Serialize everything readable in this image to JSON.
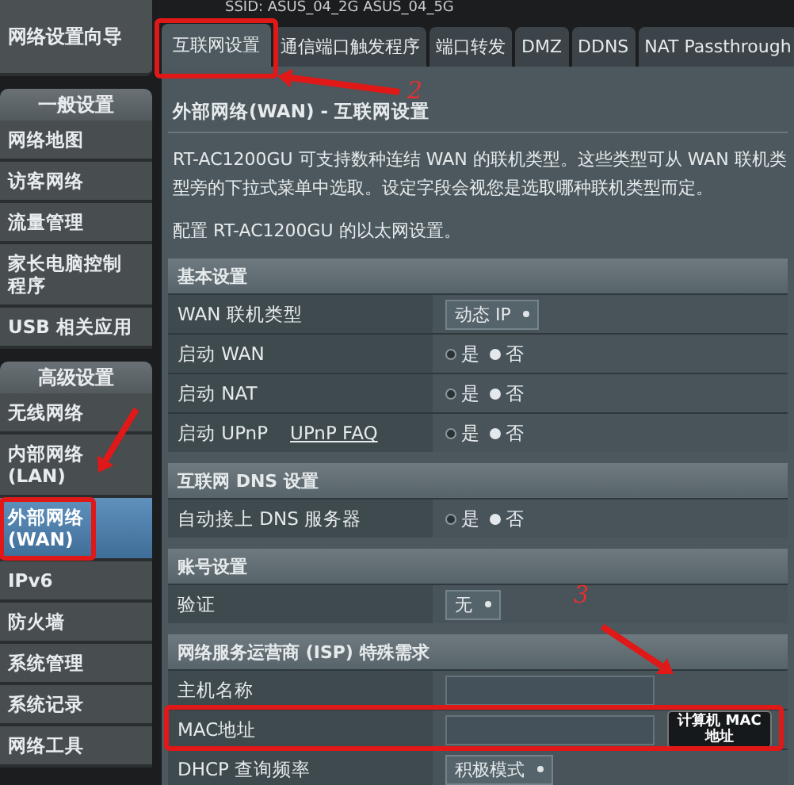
{
  "ssid": "SSID: ASUS_04_2G  ASUS_04_5G",
  "sidebar": {
    "wizard": "网络设置向导",
    "groups": [
      {
        "title": "一般设置",
        "items": [
          {
            "label": "网络地图",
            "selected": false
          },
          {
            "label": "访客网络",
            "selected": false
          },
          {
            "label": "流量管理",
            "selected": false
          },
          {
            "label": "家长电脑控制程序",
            "selected": false
          },
          {
            "label": "USB 相关应用",
            "selected": false
          }
        ]
      },
      {
        "title": "高级设置",
        "items": [
          {
            "label": "无线网络",
            "selected": false
          },
          {
            "label": "内部网络(LAN)",
            "selected": false
          },
          {
            "label": "外部网络(WAN)",
            "selected": true
          },
          {
            "label": "IPv6",
            "selected": false
          },
          {
            "label": "防火墙",
            "selected": false
          },
          {
            "label": "系统管理",
            "selected": false
          },
          {
            "label": "系统记录",
            "selected": false
          },
          {
            "label": "网络工具",
            "selected": false
          }
        ]
      }
    ]
  },
  "tabs": [
    {
      "label": "互联网设置",
      "selected": true
    },
    {
      "label": "通信端口触发程序",
      "selected": false
    },
    {
      "label": "端口转发",
      "selected": false
    },
    {
      "label": "DMZ",
      "selected": false
    },
    {
      "label": "DDNS",
      "selected": false
    },
    {
      "label": "NAT Passthrough",
      "selected": false
    }
  ],
  "page_title": "外部网络(WAN) - 互联网设置",
  "description": "RT-AC1200GU 可支持数种连结 WAN 的联机类型。这些类型可从 WAN 联机类型旁的下拉式菜单中选取。设定字段会视您是选取哪种联机类型而定。",
  "config_note": "配置 RT-AC1200GU 的以太网设置。",
  "sections": [
    {
      "title": "基本设置",
      "rows": [
        {
          "label": "WAN 联机类型",
          "kind": "select",
          "value": "动态 IP"
        },
        {
          "label": "启动 WAN",
          "kind": "radio",
          "options": [
            {
              "label": "是",
              "selected": false
            },
            {
              "label": "否",
              "selected": true
            }
          ]
        },
        {
          "label": "启动 NAT",
          "kind": "radio",
          "options": [
            {
              "label": "是",
              "selected": false
            },
            {
              "label": "否",
              "selected": true
            }
          ]
        },
        {
          "label": "启动 UPnP",
          "link": "UPnP  FAQ",
          "kind": "radio",
          "options": [
            {
              "label": "是",
              "selected": false
            },
            {
              "label": "否",
              "selected": true
            }
          ]
        }
      ]
    },
    {
      "title": "互联网 DNS 设置",
      "rows": [
        {
          "label": "自动接上 DNS 服务器",
          "kind": "radio",
          "options": [
            {
              "label": "是",
              "selected": false
            },
            {
              "label": "否",
              "selected": true
            }
          ]
        }
      ]
    },
    {
      "title": "账号设置",
      "rows": [
        {
          "label": "验证",
          "kind": "select",
          "value": "无"
        }
      ]
    },
    {
      "title": "网络服务运营商 (ISP) 特殊需求",
      "rows": [
        {
          "label": "主机名称",
          "kind": "text"
        },
        {
          "label": "MAC地址",
          "kind": "mac",
          "button": "计算机 MAC 地址"
        },
        {
          "label": "DHCP 查询频率",
          "kind": "select",
          "value": "积极模式"
        }
      ]
    }
  ],
  "annotations": {
    "marks": [
      "2",
      "3"
    ]
  }
}
